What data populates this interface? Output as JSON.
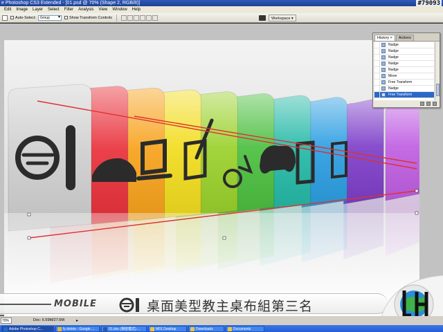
{
  "window": {
    "title": "e Photoshop CS3 Extended - [01.psd @ 70% (Shape 2, RGB/8)]",
    "overlay_id": "#79093"
  },
  "menu": [
    "Edit",
    "Image",
    "Layer",
    "Select",
    "Filter",
    "Analysis",
    "View",
    "Window",
    "Help"
  ],
  "options_bar": {
    "auto_select_label": "Auto-Select:",
    "auto_select_value": "Group",
    "transform_label": "Show Transform Controls",
    "workspace_label": "Workspace ▾"
  },
  "history_panel": {
    "tabs": [
      "History ×",
      "Actions"
    ],
    "rows": [
      {
        "label": "Nudge",
        "selected": false
      },
      {
        "label": "Nudge",
        "selected": false
      },
      {
        "label": "Nudge",
        "selected": false
      },
      {
        "label": "Nudge",
        "selected": false
      },
      {
        "label": "Nudge",
        "selected": false
      },
      {
        "label": "Move",
        "selected": false
      },
      {
        "label": "Free Transform",
        "selected": false
      },
      {
        "label": "Nudge",
        "selected": false
      },
      {
        "label": "Free Transform",
        "selected": true
      }
    ]
  },
  "banner": {
    "mobile": "MOBILE",
    "text": "桌面美型教主桌布組第三名"
  },
  "canvas": {
    "card_colors": [
      "#cfcfcf",
      "#e8303a",
      "#f7a21b",
      "#f2dc1d",
      "#9ad12b",
      "#4bbf3f",
      "#25b9a7",
      "#2c9ee2",
      "#7e3fc9",
      "#c05fe3"
    ],
    "guide_color": "#e03030"
  },
  "status": {
    "zoom": "70%",
    "doc": "Doc: 6.59M/27.6M"
  },
  "taskbar": [
    {
      "label": "Adobe Photoshop C...",
      "icon_color": "#1a6fd1",
      "active": true
    },
    {
      "label": "fy delete - Google ...",
      "icon_color": "#e9b23a",
      "active": false
    },
    {
      "label": "01.doc (相容模式) ...",
      "icon_color": "#2b5aa8",
      "active": false
    },
    {
      "label": "M01 Desktop",
      "icon_color": "#f0c040",
      "active": false
    },
    {
      "label": "Downloads",
      "icon_color": "#f0c040",
      "active": false
    },
    {
      "label": "Documents",
      "icon_color": "#f0c040",
      "active": false
    }
  ]
}
